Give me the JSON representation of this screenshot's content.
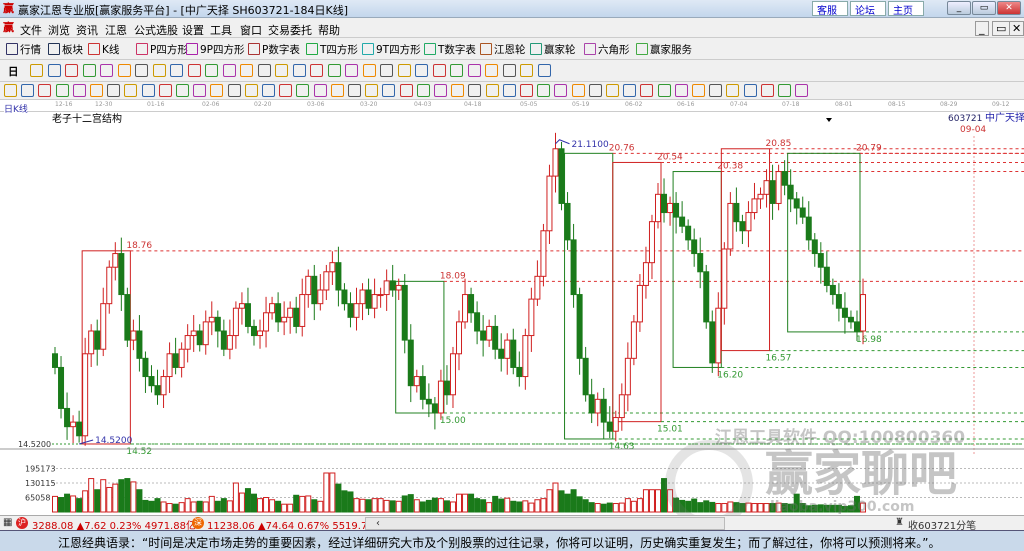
{
  "window": {
    "title": "赢家江恩专业版[赢家服务平台] - [中广天择  SH603721-184日K线]",
    "links": [
      "客服",
      "论坛",
      "主页"
    ],
    "controls": [
      "_",
      "▭",
      "✕"
    ]
  },
  "menu": [
    "文件",
    "浏览",
    "资讯",
    "江恩",
    "公式选股",
    "设置",
    "工具",
    "窗口",
    "交易委托",
    "帮助"
  ],
  "mdi_controls": [
    "_",
    "▭",
    "✕"
  ],
  "toolbar1": [
    {
      "label": "行情",
      "icon": "quote-icon"
    },
    {
      "label": "板块",
      "icon": "sector-icon"
    },
    {
      "label": "K线",
      "icon": "kline-icon"
    },
    {
      "label": "P四方形",
      "icon": "ps-icon"
    },
    {
      "label": "9P四方形",
      "icon": "p9-icon"
    },
    {
      "label": "P数字表",
      "icon": "pn-icon"
    },
    {
      "label": "T四方形",
      "icon": "ts-icon"
    },
    {
      "label": "9T四方形",
      "icon": "t9-icon"
    },
    {
      "label": "T数字表",
      "icon": "tn-icon"
    },
    {
      "label": "江恩轮",
      "icon": "gann-wheel-icon"
    },
    {
      "label": "赢家轮",
      "icon": "winner-wheel-icon"
    },
    {
      "label": "六角形",
      "icon": "hexagon-icon"
    },
    {
      "label": "赢家服务",
      "icon": "dollar-icon"
    }
  ],
  "period_label": "日",
  "chart": {
    "period_tag": "日K线",
    "indicator_name": "老子十二宫结构",
    "stock_code": "603721",
    "stock_name": "中广天择",
    "date_ticks": [
      "12-16",
      "12-30",
      "01-16",
      "02-06",
      "02-20",
      "03-06",
      "03-20",
      "04-03",
      "04-18",
      "05-05",
      "05-19",
      "06-02",
      "06-16",
      "07-04",
      "07-18",
      "08-01",
      "08-15",
      "08-29",
      "09-12"
    ],
    "future_date": "09-04",
    "price_axis_label": "14.5200",
    "high_marker": "21.1100",
    "low_marker": "14.5200",
    "price_range": [
      14.3,
      21.5
    ],
    "closes": [
      16.2,
      15.3,
      14.9,
      15.0,
      14.7,
      16.5,
      17.0,
      16.6,
      17.6,
      18.4,
      18.7,
      17.8,
      16.8,
      17.0,
      16.4,
      16.0,
      15.8,
      15.6,
      16.0,
      16.5,
      16.2,
      16.6,
      16.9,
      17.0,
      16.7,
      17.2,
      17.3,
      17.0,
      16.6,
      16.9,
      17.5,
      17.6,
      17.1,
      16.9,
      17.0,
      17.4,
      17.6,
      17.2,
      17.3,
      17.5,
      17.1,
      17.8,
      18.2,
      17.6,
      17.9,
      18.3,
      18.5,
      17.9,
      17.6,
      17.3,
      17.6,
      17.9,
      17.5,
      17.8,
      17.8,
      18.1,
      17.9,
      18.0,
      16.8,
      15.8,
      16.0,
      15.5,
      15.4,
      15.2,
      15.9,
      15.6,
      16.5,
      17.2,
      17.8,
      17.4,
      17.0,
      16.8,
      17.1,
      16.6,
      16.4,
      16.8,
      16.2,
      16.0,
      16.9,
      17.7,
      18.2,
      19.2,
      20.4,
      21.0,
      19.8,
      19.0,
      17.8,
      16.4,
      15.6,
      15.2,
      15.5,
      15.0,
      14.8,
      15.1,
      15.6,
      16.4,
      17.2,
      18.0,
      18.5,
      19.4,
      20.0,
      19.6,
      19.8,
      19.5,
      19.3,
      19.0,
      18.7,
      18.3,
      17.2,
      16.3,
      17.5,
      18.8,
      19.8,
      19.4,
      19.2,
      19.6,
      19.9,
      20.0,
      20.3,
      19.8,
      20.5,
      20.2,
      19.9,
      19.7,
      19.5,
      19.0,
      18.7,
      18.4,
      18.0,
      17.8,
      17.5,
      17.3,
      17.2,
      17.0,
      17.8
    ],
    "boxes": [
      {
        "from": 5,
        "to": 12,
        "top": 18.76,
        "bottom": 14.52,
        "color": "#d02020",
        "top_label": "18.76",
        "bottom_label": "14.52"
      },
      {
        "from": 57,
        "to": 64,
        "top": 18.09,
        "bottom": 15.2,
        "color": "#208020",
        "top_label": "18.09",
        "bottom_label": "15.00"
      },
      {
        "from": 85,
        "to": 92,
        "top": 20.9,
        "bottom": 14.63,
        "color": "#208020",
        "top_label": "20.76",
        "bottom_label": "14.63"
      },
      {
        "from": 93,
        "to": 100,
        "top": 20.7,
        "bottom": 15.01,
        "color": "#d02020",
        "top_label": "20.54",
        "bottom_label": "15.01"
      },
      {
        "from": 103,
        "to": 110,
        "top": 20.5,
        "bottom": 16.2,
        "color": "#208020",
        "top_label": "20.38",
        "bottom_label": "16.20"
      },
      {
        "from": 111,
        "to": 118,
        "top": 21.0,
        "bottom": 16.57,
        "color": "#d02020",
        "top_label": "20.85",
        "bottom_label": "16.57"
      },
      {
        "from": 122,
        "to": 133,
        "top": 20.9,
        "bottom": 16.98,
        "color": "#208020",
        "top_label": "20.79",
        "bottom_label": "16.98"
      }
    ],
    "volume_ticks": [
      "195173",
      "130115",
      "65058"
    ],
    "volumes": [
      70000,
      65000,
      80000,
      72000,
      60000,
      95000,
      150000,
      100000,
      145000,
      110000,
      125000,
      145000,
      150000,
      135000,
      100000,
      52000,
      48000,
      60000,
      45000,
      38000,
      35000,
      42000,
      60000,
      45000,
      48000,
      45000,
      70000,
      48000,
      60000,
      50000,
      130000,
      85000,
      105000,
      80000,
      60000,
      65000,
      55000,
      48000,
      35000,
      35000,
      75000,
      70000,
      72000,
      55000,
      48000,
      175000,
      175000,
      125000,
      95000,
      90000,
      60000,
      57000,
      55000,
      60000,
      60000,
      52000,
      50000,
      48000,
      72000,
      78000,
      55000,
      45000,
      52000,
      62000,
      60000,
      50000,
      45000,
      80000,
      80000,
      80000,
      60000,
      55000,
      42000,
      70000,
      58000,
      62000,
      48000,
      45000,
      50000,
      40000,
      55000,
      60000,
      100000,
      130000,
      95000,
      80000,
      100000,
      68000,
      55000,
      42000,
      38000,
      35000,
      40000,
      38000,
      40000,
      60000,
      48000,
      60000,
      100000,
      100000,
      100000,
      150000,
      100000,
      62000,
      52000,
      48000,
      58000,
      42000,
      50000,
      43000,
      38000,
      38000,
      45000,
      42000,
      38000,
      40000,
      38000,
      38000,
      38000,
      38000,
      40000,
      38000,
      35000,
      80000,
      38000,
      28000,
      30000,
      32000,
      30000,
      30000,
      30000,
      25000,
      28000,
      70000,
      40000
    ],
    "watermark_qq": "江恩工具软件  QQ:100800360",
    "watermark_brand": "赢家聊吧",
    "watermark_url": "liaoba.vip300.com"
  },
  "status": {
    "sh_index": "3288.08 ▲7.62 0.23% 4971.88亿",
    "sz_index": "11238.06 ▲74.64 0.67% 5519.72亿",
    "right": "收603721分笔"
  },
  "quote": "江恩经典语录：“时间是决定市场走势的重要因素，经过详细研究大市及个别股票的过往记录，你将可以证明，历史确实重复发生；而了解过往，你将可以预测将来。”。",
  "colors": {
    "up": "#d02020",
    "down": "#1a7a1a",
    "title_bg": "#c3d6ec",
    "quote_bg": "#c9d9ea"
  }
}
